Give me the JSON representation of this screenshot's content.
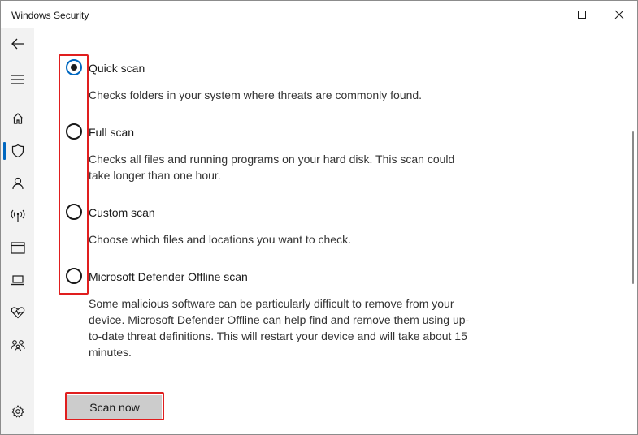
{
  "window": {
    "title": "Windows Security"
  },
  "sidebar": {
    "items": [
      {
        "name": "back",
        "icon": "back-arrow-icon"
      },
      {
        "name": "menu",
        "icon": "hamburger-menu-icon"
      },
      {
        "name": "home",
        "icon": "home-icon"
      },
      {
        "name": "virus-threat-protection",
        "icon": "shield-icon",
        "active": true
      },
      {
        "name": "account-protection",
        "icon": "person-icon"
      },
      {
        "name": "firewall-network",
        "icon": "wireless-antenna-icon"
      },
      {
        "name": "app-browser-control",
        "icon": "browser-window-icon"
      },
      {
        "name": "device-security",
        "icon": "laptop-icon"
      },
      {
        "name": "device-performance",
        "icon": "heart-pulse-icon"
      },
      {
        "name": "family-options",
        "icon": "family-icon"
      },
      {
        "name": "settings",
        "icon": "gear-icon"
      }
    ]
  },
  "scan_options": [
    {
      "label": "Quick scan",
      "description": "Checks folders in your system where threats are commonly found.",
      "selected": true
    },
    {
      "label": "Full scan",
      "description": "Checks all files and running programs on your hard disk. This scan could take longer than one hour.",
      "selected": false
    },
    {
      "label": "Custom scan",
      "description": "Choose which files and locations you want to check.",
      "selected": false
    },
    {
      "label": "Microsoft Defender Offline scan",
      "description": "Some malicious software can be particularly difficult to remove from your device. Microsoft Defender Offline can help find and remove them using up-to-date threat definitions. This will restart your device and will take about 15 minutes.",
      "selected": false
    }
  ],
  "actions": {
    "scan_now_label": "Scan now"
  },
  "colors": {
    "accent": "#0067c0",
    "highlight_frame": "#e01e1e",
    "sidebar_bg": "#f2f2f2",
    "button_bg": "#cccccc"
  }
}
